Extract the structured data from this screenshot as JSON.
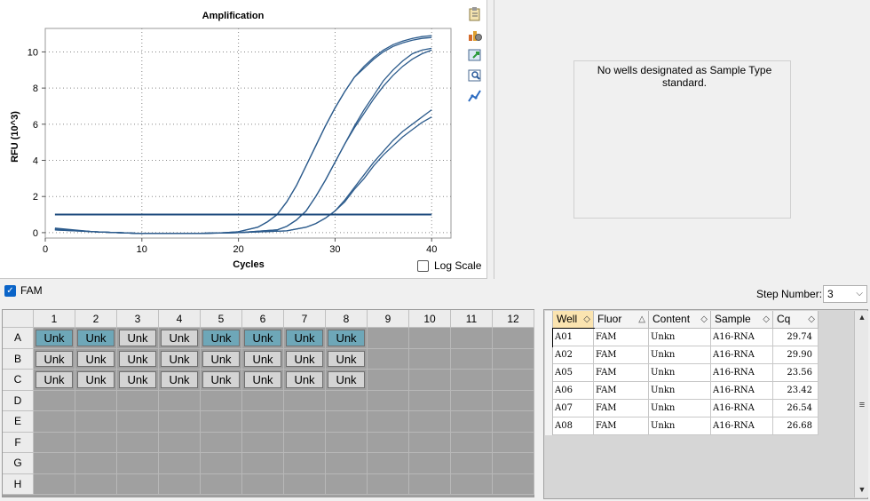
{
  "chart": {
    "title": "Amplification",
    "ylabel": "RFU (10^3)",
    "xlabel": "Cycles",
    "log_scale_label": "Log Scale",
    "log_scale_checked": false
  },
  "chart_data": {
    "type": "line",
    "title": "Amplification",
    "xlabel": "Cycles",
    "ylabel": "RFU (10^3)",
    "xlim": [
      0,
      42
    ],
    "ylim": [
      -0.3,
      11.3
    ],
    "xticks": [
      0,
      10,
      20,
      30,
      40
    ],
    "yticks": [
      0,
      2,
      4,
      6,
      8,
      10
    ],
    "grid": true,
    "threshold": 1.0,
    "series": [
      {
        "x": [
          1,
          5,
          10,
          15,
          18,
          20,
          22,
          23,
          24,
          25,
          26,
          27,
          28,
          29,
          30,
          31,
          32,
          33,
          34,
          35,
          36,
          37,
          38,
          39,
          40
        ],
        "y": [
          0.2,
          0.05,
          -0.05,
          -0.05,
          -0.02,
          0.05,
          0.3,
          0.6,
          1.0,
          1.7,
          2.6,
          3.7,
          4.8,
          5.9,
          6.9,
          7.8,
          8.6,
          9.2,
          9.7,
          10.1,
          10.4,
          10.6,
          10.75,
          10.85,
          10.9
        ]
      },
      {
        "x": [
          1,
          5,
          10,
          15,
          18,
          20,
          22,
          23,
          24,
          25,
          26,
          27,
          28,
          29,
          30,
          31,
          32,
          33,
          34,
          35,
          36,
          37,
          38,
          39,
          40
        ],
        "y": [
          0.25,
          0.05,
          -0.05,
          -0.05,
          -0.02,
          0.05,
          0.3,
          0.6,
          1.0,
          1.7,
          2.6,
          3.7,
          4.8,
          5.9,
          6.9,
          7.8,
          8.6,
          9.1,
          9.6,
          10.0,
          10.3,
          10.5,
          10.65,
          10.75,
          10.8
        ]
      },
      {
        "x": [
          1,
          5,
          10,
          15,
          20,
          24,
          25,
          26,
          27,
          28,
          29,
          30,
          31,
          32,
          33,
          34,
          35,
          36,
          37,
          38,
          39,
          40
        ],
        "y": [
          0.2,
          0.05,
          -0.05,
          -0.05,
          0.0,
          0.15,
          0.35,
          0.7,
          1.2,
          2.0,
          2.9,
          3.9,
          4.9,
          5.9,
          6.8,
          7.6,
          8.4,
          9.0,
          9.5,
          9.9,
          10.1,
          10.2
        ]
      },
      {
        "x": [
          1,
          5,
          10,
          15,
          20,
          24,
          25,
          26,
          27,
          28,
          29,
          30,
          31,
          32,
          33,
          34,
          35,
          36,
          37,
          38,
          39,
          40
        ],
        "y": [
          0.2,
          0.05,
          -0.05,
          -0.05,
          0.0,
          0.15,
          0.35,
          0.7,
          1.2,
          2.0,
          2.9,
          3.9,
          4.9,
          5.8,
          6.6,
          7.4,
          8.1,
          8.7,
          9.2,
          9.6,
          9.9,
          10.1
        ]
      },
      {
        "x": [
          1,
          5,
          10,
          15,
          20,
          25,
          27,
          28,
          29,
          30,
          31,
          32,
          33,
          34,
          35,
          36,
          37,
          38,
          39,
          40
        ],
        "y": [
          0.15,
          0.05,
          -0.05,
          -0.05,
          0.0,
          0.1,
          0.3,
          0.5,
          0.8,
          1.2,
          1.8,
          2.5,
          3.2,
          3.9,
          4.5,
          5.1,
          5.6,
          6.0,
          6.4,
          6.8
        ]
      },
      {
        "x": [
          1,
          5,
          10,
          15,
          20,
          25,
          27,
          28,
          29,
          30,
          31,
          32,
          33,
          34,
          35,
          36,
          37,
          38,
          39,
          40
        ],
        "y": [
          0.15,
          0.05,
          -0.05,
          -0.05,
          0.0,
          0.1,
          0.3,
          0.5,
          0.8,
          1.2,
          1.7,
          2.4,
          3.0,
          3.7,
          4.3,
          4.8,
          5.3,
          5.7,
          6.1,
          6.4
        ]
      }
    ]
  },
  "standard": {
    "message": "No wells designated as Sample Type standard."
  },
  "fluor": {
    "label": "FAM",
    "checked": true
  },
  "step": {
    "label": "Step Number:",
    "value": "3"
  },
  "plate": {
    "columns": [
      "1",
      "2",
      "3",
      "4",
      "5",
      "6",
      "7",
      "8",
      "9",
      "10",
      "11",
      "12"
    ],
    "rows": [
      "A",
      "B",
      "C",
      "D",
      "E",
      "F",
      "G",
      "H"
    ],
    "well_label": "Unk",
    "selected_wells": [
      "A1",
      "A2",
      "A5",
      "A6",
      "A7",
      "A8"
    ],
    "filled_rows": [
      "A",
      "B",
      "C"
    ],
    "filled_cols": 8,
    "colors": {
      "selected": "#6ea7b8",
      "unselected": "#d4d4d4",
      "empty": "#a0a0a0"
    }
  },
  "table": {
    "columns": [
      "Well",
      "Fluor",
      "Content",
      "Sample",
      "Cq"
    ],
    "rows": [
      {
        "well": "A01",
        "fluor": "FAM",
        "content": "Unkn",
        "sample": "A16-RNA",
        "cq": "29.74"
      },
      {
        "well": "A02",
        "fluor": "FAM",
        "content": "Unkn",
        "sample": "A16-RNA",
        "cq": "29.90"
      },
      {
        "well": "A05",
        "fluor": "FAM",
        "content": "Unkn",
        "sample": "A16-RNA",
        "cq": "23.56"
      },
      {
        "well": "A06",
        "fluor": "FAM",
        "content": "Unkn",
        "sample": "A16-RNA",
        "cq": "23.42"
      },
      {
        "well": "A07",
        "fluor": "FAM",
        "content": "Unkn",
        "sample": "A16-RNA",
        "cq": "26.54"
      },
      {
        "well": "A08",
        "fluor": "FAM",
        "content": "Unkn",
        "sample": "A16-RNA",
        "cq": "26.68"
      }
    ]
  },
  "icons": [
    "clipboard-icon",
    "chart-settings-icon",
    "export-icon",
    "zoom-chart-icon",
    "line-chart-icon"
  ]
}
